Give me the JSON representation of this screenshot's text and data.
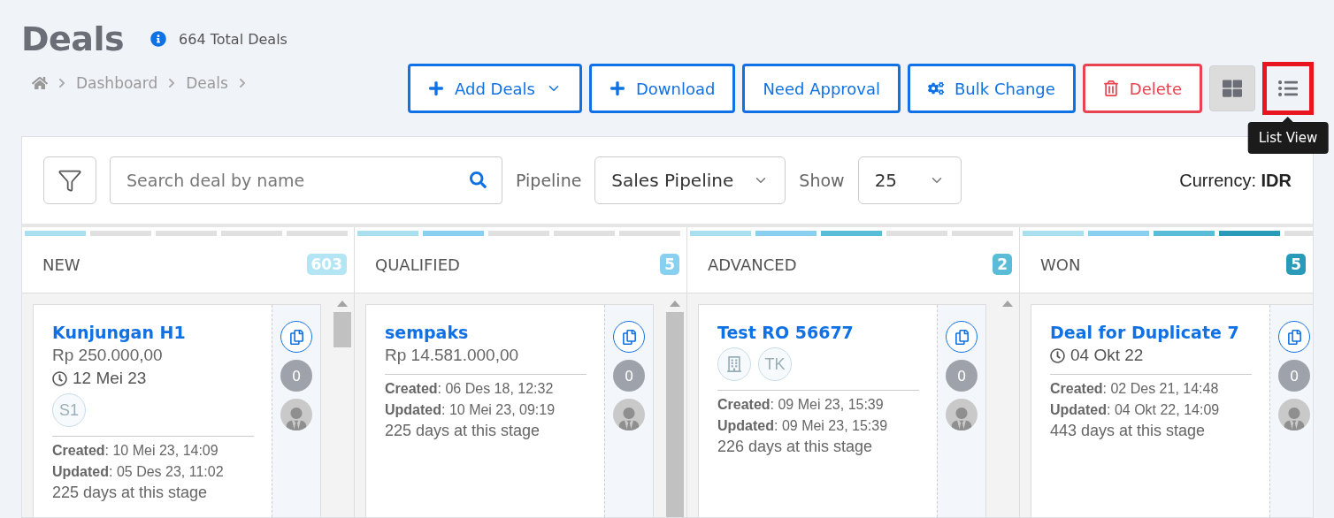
{
  "header": {
    "title": "Deals",
    "total": "664 Total Deals",
    "breadcrumb": [
      "Dashboard",
      "Deals"
    ]
  },
  "actions": [
    {
      "label": "Add Deals",
      "kind": "add",
      "caret": true
    },
    {
      "label": "Download",
      "kind": "download",
      "caret": false
    },
    {
      "label": "Need Approval",
      "kind": "approval",
      "caret": false
    },
    {
      "label": "Bulk Change",
      "kind": "bulk",
      "caret": false
    },
    {
      "label": "Delete",
      "kind": "delete",
      "caret": false
    }
  ],
  "views": [
    {
      "kind": "grid",
      "selected": true,
      "highlighted": false
    },
    {
      "kind": "list",
      "selected": false,
      "highlighted": true,
      "tooltip": "List View"
    }
  ],
  "filters": {
    "search_placeholder": "Search deal by name",
    "pipeline_label": "Pipeline",
    "pipeline": "Sales Pipeline",
    "show_label": "Show",
    "show": "25",
    "currency": "Currency: **IDR**"
  },
  "columns": [
    {
      "name": "NEW",
      "count": "603",
      "color": "#b3e5f5",
      "segments": [
        {
          "filled": true
        },
        {
          "filled": false
        },
        {
          "filled": false
        },
        {
          "filled": false
        },
        {
          "filled": false
        }
      ],
      "cards": [
        {
          "title": "Kunjungan H1",
          "amount": "Rp 250.000,00",
          "due": "12 Mei 23",
          "tags": [
            {
              "kind": "text",
              "label": "S1"
            }
          ],
          "created": "**Created**: 10 Mei 23, 14:09",
          "updated": "**Updated**: 05 Des 23, 11:02",
          "days": "225 days at this stage",
          "comments": "0"
        }
      ]
    },
    {
      "name": "QUALIFIED",
      "count": "5",
      "color": "#87d0ef",
      "segments": [
        {
          "filled": true
        },
        {
          "filled": true
        },
        {
          "filled": false
        },
        {
          "filled": false
        },
        {
          "filled": false
        }
      ],
      "cards": [
        {
          "title": "sempaks",
          "amount": "Rp 14.581.000,00",
          "created": "**Created**: 06 Des 18, 12:32",
          "updated": "**Updated**: 10 Mei 23, 09:19",
          "days": "225 days at this stage",
          "comments": "0"
        }
      ]
    },
    {
      "name": "ADVANCED",
      "count": "2",
      "color": "#5bbcd8",
      "segments": [
        {
          "filled": true
        },
        {
          "filled": true
        },
        {
          "filled": true
        },
        {
          "filled": false
        },
        {
          "filled": false
        }
      ],
      "cards": [
        {
          "title": "Test RO 56677",
          "tags": [
            {
              "kind": "building"
            },
            {
              "kind": "text",
              "label": "TK"
            }
          ],
          "created": "**Created**: 09 Mei 23, 15:39",
          "updated": "**Updated**: 09 Mei 23, 15:39",
          "days": "226 days at this stage",
          "comments": "0"
        }
      ]
    },
    {
      "name": "WON",
      "count": "5",
      "color": "#2a9ab9",
      "segments": [
        {
          "filled": true
        },
        {
          "filled": true
        },
        {
          "filled": true
        },
        {
          "filled": true
        },
        {
          "filled": false
        }
      ],
      "cards": [
        {
          "title": "Deal for Duplicate 7",
          "due": "04 Okt 22",
          "created": "**Created**: 02 Des 21, 14:48",
          "updated": "**Updated**: 04 Okt 22, 14:09",
          "days": "443 days at this stage",
          "comments": "0"
        }
      ]
    }
  ]
}
